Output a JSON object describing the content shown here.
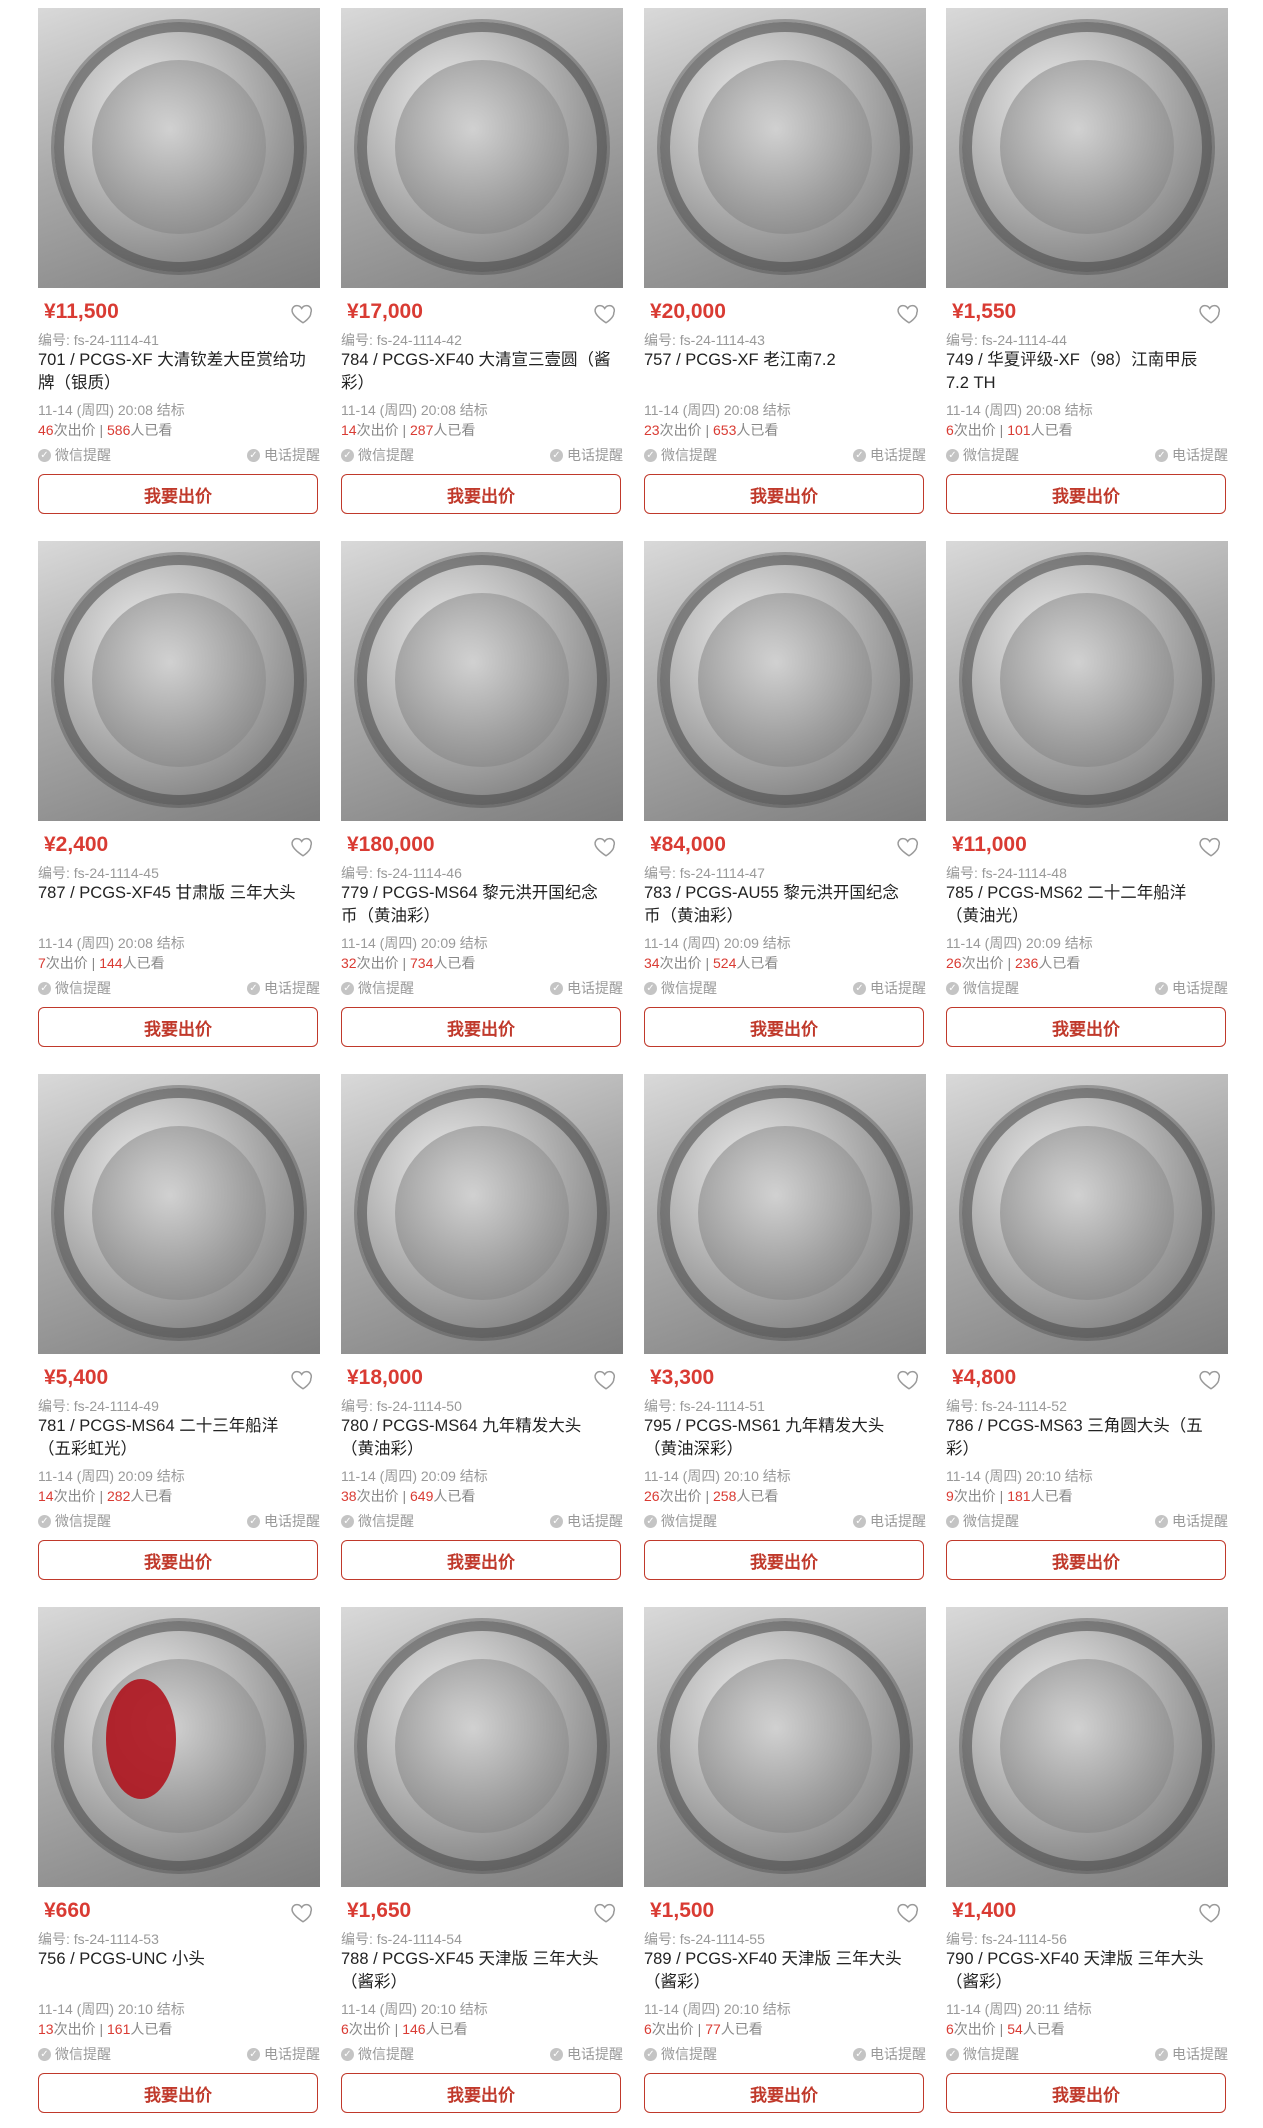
{
  "columns": 4,
  "items": [
    {
      "price": "¥11,500",
      "code": "编号: fs-24-1114-41",
      "title": "701 / PCGS-XF 大清钦差大臣赏给功牌（银质）",
      "end_time": "11-14 (周四) 20:08 结标",
      "bids": "46",
      "bids_suffix": "次出价",
      "views": "586",
      "views_suffix": "人已看",
      "wechat_remind": "微信提醒",
      "phone_remind": "电话提醒",
      "bid_button": "我要出价"
    },
    {
      "price": "¥17,000",
      "code": "编号: fs-24-1114-42",
      "title": "784 / PCGS-XF40 大清宣三壹圆（酱彩）",
      "end_time": "11-14 (周四) 20:08 结标",
      "bids": "14",
      "bids_suffix": "次出价",
      "views": "287",
      "views_suffix": "人已看",
      "wechat_remind": "微信提醒",
      "phone_remind": "电话提醒",
      "bid_button": "我要出价"
    },
    {
      "price": "¥20,000",
      "code": "编号: fs-24-1114-43",
      "title": "757 / PCGS-XF 老江南7.2",
      "end_time": "11-14 (周四) 20:08 结标",
      "bids": "23",
      "bids_suffix": "次出价",
      "views": "653",
      "views_suffix": "人已看",
      "wechat_remind": "微信提醒",
      "phone_remind": "电话提醒",
      "bid_button": "我要出价"
    },
    {
      "price": "¥1,550",
      "code": "编号: fs-24-1114-44",
      "title": "749 / 华夏评级-XF（98）江南甲辰7.2 TH",
      "end_time": "11-14 (周四) 20:08 结标",
      "bids": "6",
      "bids_suffix": "次出价",
      "views": "101",
      "views_suffix": "人已看",
      "wechat_remind": "微信提醒",
      "phone_remind": "电话提醒",
      "bid_button": "我要出价"
    },
    {
      "price": "¥2,400",
      "code": "编号: fs-24-1114-45",
      "title": "787 / PCGS-XF45 甘肃版 三年大头",
      "end_time": "11-14 (周四) 20:08 结标",
      "bids": "7",
      "bids_suffix": "次出价",
      "views": "144",
      "views_suffix": "人已看",
      "wechat_remind": "微信提醒",
      "phone_remind": "电话提醒",
      "bid_button": "我要出价"
    },
    {
      "price": "¥180,000",
      "code": "编号: fs-24-1114-46",
      "title": "779 / PCGS-MS64 黎元洪开国纪念币（黄油彩）",
      "end_time": "11-14 (周四) 20:09 结标",
      "bids": "32",
      "bids_suffix": "次出价",
      "views": "734",
      "views_suffix": "人已看",
      "wechat_remind": "微信提醒",
      "phone_remind": "电话提醒",
      "bid_button": "我要出价"
    },
    {
      "price": "¥84,000",
      "code": "编号: fs-24-1114-47",
      "title": "783 / PCGS-AU55 黎元洪开国纪念币（黄油彩）",
      "end_time": "11-14 (周四) 20:09 结标",
      "bids": "34",
      "bids_suffix": "次出价",
      "views": "524",
      "views_suffix": "人已看",
      "wechat_remind": "微信提醒",
      "phone_remind": "电话提醒",
      "bid_button": "我要出价"
    },
    {
      "price": "¥11,000",
      "code": "编号: fs-24-1114-48",
      "title": "785 / PCGS-MS62 二十二年船洋（黄油光）",
      "end_time": "11-14 (周四) 20:09 结标",
      "bids": "26",
      "bids_suffix": "次出价",
      "views": "236",
      "views_suffix": "人已看",
      "wechat_remind": "微信提醒",
      "phone_remind": "电话提醒",
      "bid_button": "我要出价"
    },
    {
      "price": "¥5,400",
      "code": "编号: fs-24-1114-49",
      "title": "781 / PCGS-MS64 二十三年船洋（五彩虹光）",
      "end_time": "11-14 (周四) 20:09 结标",
      "bids": "14",
      "bids_suffix": "次出价",
      "views": "282",
      "views_suffix": "人已看",
      "wechat_remind": "微信提醒",
      "phone_remind": "电话提醒",
      "bid_button": "我要出价"
    },
    {
      "price": "¥18,000",
      "code": "编号: fs-24-1114-50",
      "title": "780 / PCGS-MS64 九年精发大头（黄油彩）",
      "end_time": "11-14 (周四) 20:09 结标",
      "bids": "38",
      "bids_suffix": "次出价",
      "views": "649",
      "views_suffix": "人已看",
      "wechat_remind": "微信提醒",
      "phone_remind": "电话提醒",
      "bid_button": "我要出价"
    },
    {
      "price": "¥3,300",
      "code": "编号: fs-24-1114-51",
      "title": "795 / PCGS-MS61 九年精发大头（黄油深彩）",
      "end_time": "11-14 (周四) 20:10 结标",
      "bids": "26",
      "bids_suffix": "次出价",
      "views": "258",
      "views_suffix": "人已看",
      "wechat_remind": "微信提醒",
      "phone_remind": "电话提醒",
      "bid_button": "我要出价"
    },
    {
      "price": "¥4,800",
      "code": "编号: fs-24-1114-52",
      "title": "786 / PCGS-MS63 三角圆大头（五彩）",
      "end_time": "11-14 (周四) 20:10 结标",
      "bids": "9",
      "bids_suffix": "次出价",
      "views": "181",
      "views_suffix": "人已看",
      "wechat_remind": "微信提醒",
      "phone_remind": "电话提醒",
      "bid_button": "我要出价"
    },
    {
      "price": "¥660",
      "code": "编号: fs-24-1114-53",
      "title": "756 / PCGS-UNC 小头",
      "end_time": "11-14 (周四) 20:10 结标",
      "bids": "13",
      "bids_suffix": "次出价",
      "views": "161",
      "views_suffix": "人已看",
      "wechat_remind": "微信提醒",
      "phone_remind": "电话提醒",
      "bid_button": "我要出价",
      "has_red_mark": true
    },
    {
      "price": "¥1,650",
      "code": "编号: fs-24-1114-54",
      "title": "788 / PCGS-XF45 天津版 三年大头（酱彩）",
      "end_time": "11-14 (周四) 20:10 结标",
      "bids": "6",
      "bids_suffix": "次出价",
      "views": "146",
      "views_suffix": "人已看",
      "wechat_remind": "微信提醒",
      "phone_remind": "电话提醒",
      "bid_button": "我要出价"
    },
    {
      "price": "¥1,500",
      "code": "编号: fs-24-1114-55",
      "title": "789 / PCGS-XF40 天津版 三年大头（酱彩）",
      "end_time": "11-14 (周四) 20:10 结标",
      "bids": "6",
      "bids_suffix": "次出价",
      "views": "77",
      "views_suffix": "人已看",
      "wechat_remind": "微信提醒",
      "phone_remind": "电话提醒",
      "bid_button": "我要出价"
    },
    {
      "price": "¥1,400",
      "code": "编号: fs-24-1114-56",
      "title": "790 / PCGS-XF40 天津版 三年大头（酱彩）",
      "end_time": "11-14 (周四) 20:11 结标",
      "bids": "6",
      "bids_suffix": "次出价",
      "views": "54",
      "views_suffix": "人已看",
      "wechat_remind": "微信提醒",
      "phone_remind": "电话提醒",
      "bid_button": "我要出价"
    }
  ],
  "colors": {
    "accent": "#d93b33",
    "border": "#c0392b",
    "muted": "#999999"
  },
  "icons": {
    "favorite": "heart-outline-icon",
    "check": "check-circle-icon"
  }
}
